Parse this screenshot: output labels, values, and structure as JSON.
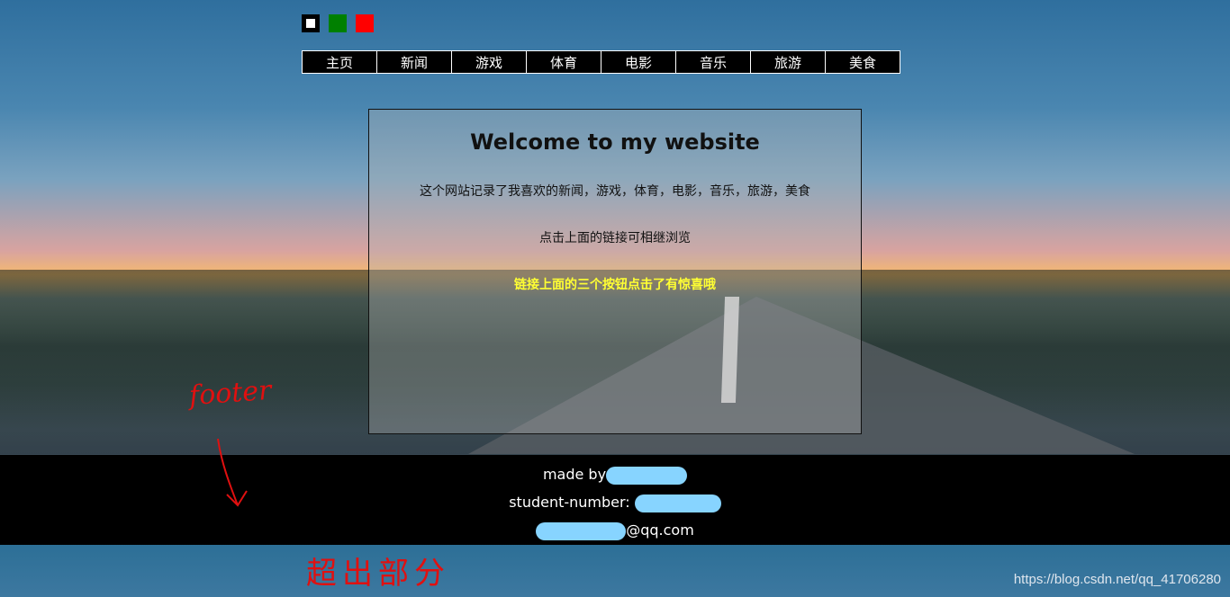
{
  "swatches": [
    {
      "name": "black",
      "color": "#000000"
    },
    {
      "name": "green",
      "color": "#008000"
    },
    {
      "name": "red",
      "color": "#ff0000"
    }
  ],
  "nav": [
    "主页",
    "新闻",
    "游戏",
    "体育",
    "电影",
    "音乐",
    "旅游",
    "美食"
  ],
  "panel": {
    "title": "Welcome to my website",
    "line1": "这个网站记录了我喜欢的新闻，游戏，体育，电影，音乐，旅游，美食",
    "line2": "点击上面的链接可相继浏览",
    "line3": "链接上面的三个按钮点击了有惊喜哦",
    "highlight_color": "#ffff33"
  },
  "footer": {
    "made_by": "made by",
    "student_number": "student-number:",
    "email_suffix": "@qq.com"
  },
  "annotations": {
    "footer": "footer",
    "exceed": "超出部分"
  },
  "watermark": "https://blog.csdn.net/qq_41706280"
}
